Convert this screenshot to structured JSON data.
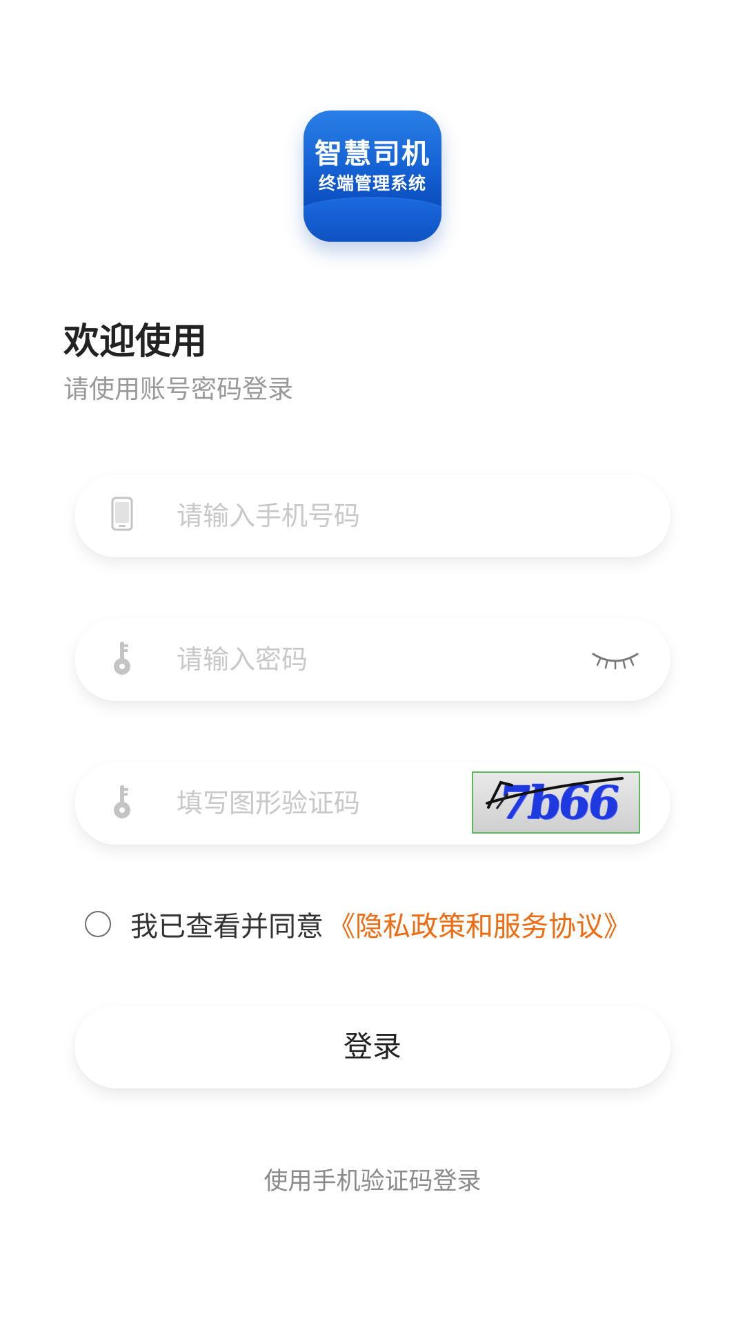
{
  "app": {
    "logo_line1": "智慧司机",
    "logo_line2": "终端管理系统",
    "brand_color": "#1461d4"
  },
  "welcome": {
    "title": "欢迎使用",
    "subtitle": "请使用账号密码登录"
  },
  "form": {
    "phone": {
      "icon": "phone-icon",
      "value": "",
      "placeholder": "请输入手机号码"
    },
    "password": {
      "icon": "key-icon",
      "value": "",
      "placeholder": "请输入密码",
      "visibility_icon": "eye-closed-icon"
    },
    "captcha": {
      "icon": "key-icon",
      "value": "",
      "placeholder": "填写图形验证码",
      "image_text": "7b66"
    }
  },
  "agreement": {
    "checked": false,
    "text": "我已查看并同意",
    "link_text": "《隐私政策和服务协议》",
    "link_color": "#f26a0f"
  },
  "login_button": {
    "label": "登录"
  },
  "alt_login": {
    "label": "使用手机验证码登录"
  }
}
